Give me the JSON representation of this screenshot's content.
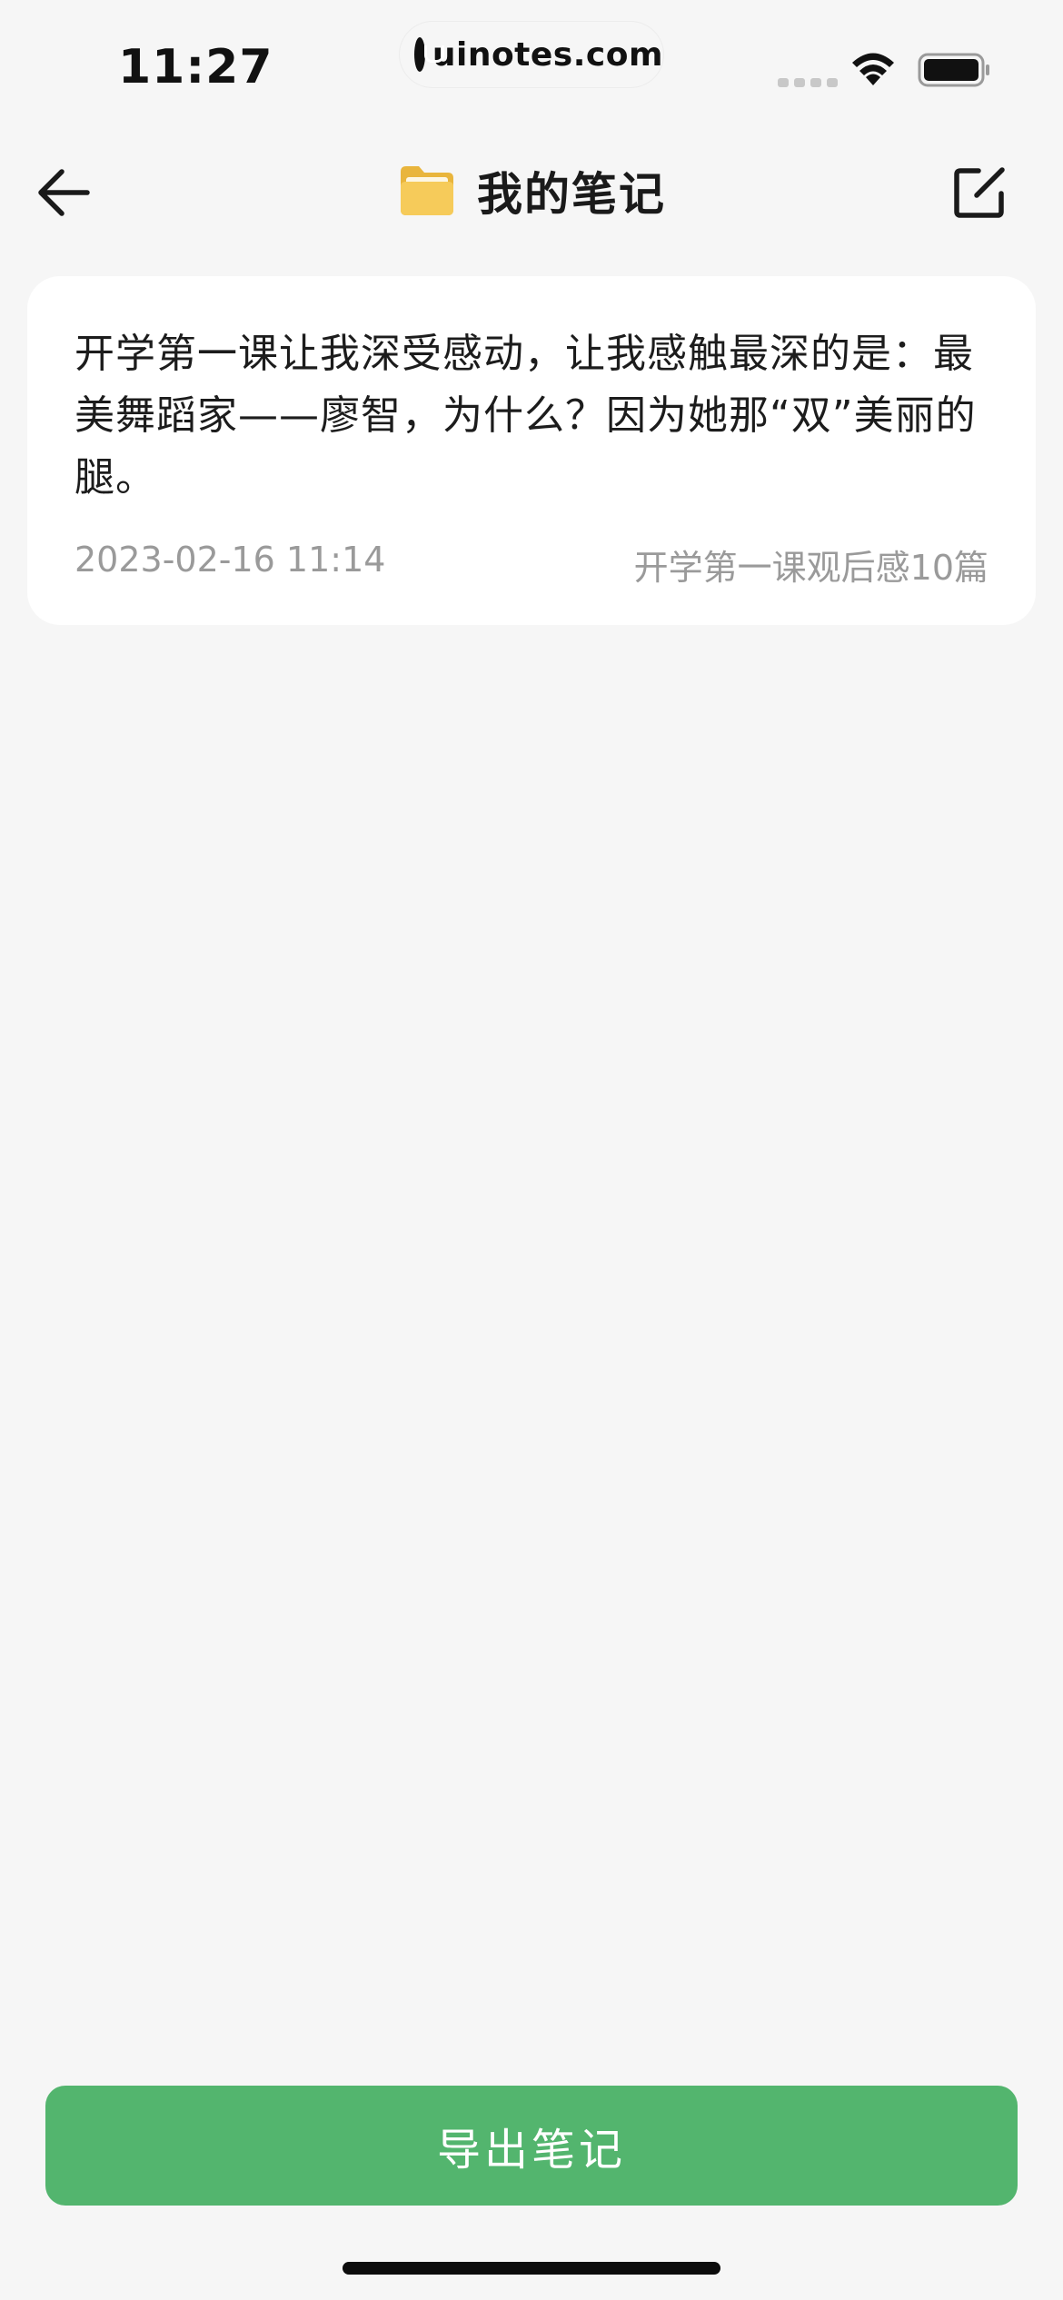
{
  "status_bar": {
    "time": "11:27",
    "watermark": "uinotes.com"
  },
  "nav": {
    "title": "我的笔记",
    "back_icon": "arrow-left-icon",
    "folder_icon": "folder-icon",
    "edit_icon": "edit-square-icon"
  },
  "notes": [
    {
      "content": "开学第一课让我深受感动，让我感触最深的是：最美舞蹈家——廖智，为什么？因为她那“双”美丽的腿。",
      "date": "2023-02-16 11:14",
      "source": "开学第一课观后感10篇"
    }
  ],
  "export_button": {
    "label": "导出笔记"
  },
  "colors": {
    "background": "#f6f6f6",
    "card": "#ffffff",
    "accent": "#53b56e",
    "meta_text": "#9a9a9a",
    "folder": "#f2c14e"
  }
}
